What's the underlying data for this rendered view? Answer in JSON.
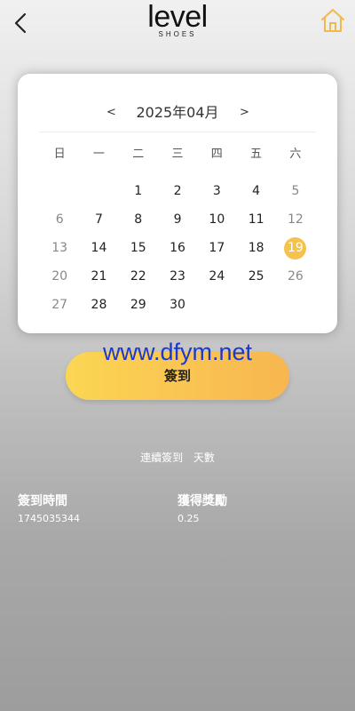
{
  "header": {
    "logo_main": "level",
    "logo_sub": "SHOES",
    "back_icon": "chevron-left-icon",
    "home_icon": "home-icon",
    "home_icon_color": "#f2b84b"
  },
  "calendar": {
    "month_label": "2025年04月",
    "prev_label": "<",
    "next_label": ">",
    "weekdays": [
      "日",
      "一",
      "二",
      "三",
      "四",
      "五",
      "六"
    ],
    "leading_blanks": 2,
    "days_in_month": 30,
    "today": 19,
    "today_color": "#f5c24e"
  },
  "signin": {
    "button_label": "簽到",
    "gradient_start": "#fbd653",
    "gradient_end": "#f8b650"
  },
  "watermark": {
    "text": "www.dfym.net",
    "color": "#1b39d1"
  },
  "streak": {
    "label": "連續簽到",
    "unit": "天數"
  },
  "records": {
    "time_header": "簽到時間",
    "reward_header": "獲得獎勵",
    "time_value": "1745035344",
    "reward_value": "0.25"
  }
}
